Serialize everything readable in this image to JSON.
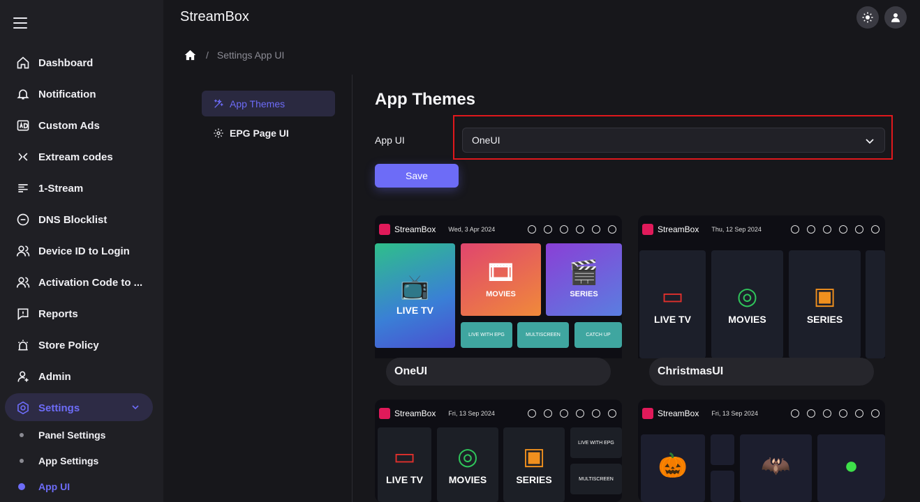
{
  "app": {
    "title": "StreamBox"
  },
  "sidebar": {
    "items": [
      {
        "label": "Dashboard",
        "icon": "home-icon"
      },
      {
        "label": "Notification",
        "icon": "bell-icon"
      },
      {
        "label": "Custom Ads",
        "icon": "ad-icon"
      },
      {
        "label": "Extream codes",
        "icon": "xtream-icon"
      },
      {
        "label": "1-Stream",
        "icon": "stream-icon"
      },
      {
        "label": "DNS Blocklist",
        "icon": "block-icon"
      },
      {
        "label": "Device ID to Login",
        "icon": "users-icon"
      },
      {
        "label": "Activation Code to ...",
        "icon": "users-icon"
      },
      {
        "label": "Reports",
        "icon": "report-icon"
      },
      {
        "label": "Store Policy",
        "icon": "alarm-icon"
      },
      {
        "label": "Admin",
        "icon": "admin-icon"
      },
      {
        "label": "Settings",
        "icon": "settings-icon"
      }
    ],
    "sub_items": [
      {
        "label": "Panel Settings"
      },
      {
        "label": "App Settings"
      },
      {
        "label": "App UI"
      }
    ]
  },
  "breadcrumb": {
    "current": "Settings App UI"
  },
  "tabs": [
    {
      "label": "App Themes"
    },
    {
      "label": "EPG Page UI"
    }
  ],
  "main": {
    "title": "App Themes",
    "field_label": "App UI",
    "select_value": "OneUI",
    "save_label": "Save"
  },
  "themes": [
    {
      "label": "OneUI",
      "date": "Wed, 3 Apr 2024",
      "tiles": [
        "LIVE TV",
        "MOVIES",
        "SERIES"
      ],
      "small": [
        "LIVE WITH EPG",
        "MULTISCREEN",
        "CATCH UP"
      ]
    },
    {
      "label": "ChristmasUI",
      "date": "Thu, 12 Sep 2024",
      "tiles": [
        "LIVE TV",
        "MOVIES",
        "SERIES"
      ]
    },
    {
      "label": "",
      "date": "Fri, 13 Sep 2024",
      "tiles": [
        "LIVE TV",
        "MOVIES",
        "SERIES"
      ],
      "small": [
        "LIVE WITH EPG",
        "MULTISCREEN"
      ]
    },
    {
      "label": "",
      "date": "Fri, 13 Sep 2024",
      "tiles": []
    }
  ],
  "colors": {
    "accent": "#6d6cf7",
    "highlight": "#e0181c",
    "brand": "#e01a5a"
  }
}
